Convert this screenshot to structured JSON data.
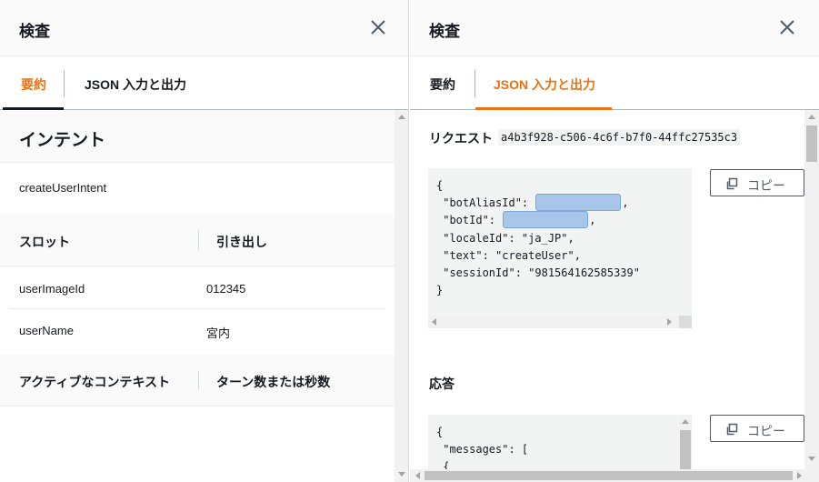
{
  "left_panel": {
    "title": "検査",
    "tabs": [
      {
        "label": "要約",
        "active": true
      },
      {
        "label": "JSON 入力と出力",
        "active": false
      }
    ],
    "intent_heading": "インテント",
    "intent_value": "createUserIntent",
    "slots_header": {
      "col1": "スロット",
      "col2": "引き出し"
    },
    "slots": [
      {
        "name": "userImageId",
        "value": "012345"
      },
      {
        "name": "userName",
        "value": "宮内"
      }
    ],
    "context_header": {
      "col1": "アクティブなコンテキスト",
      "col2": "ターン数または秒数"
    }
  },
  "right_panel": {
    "title": "検査",
    "tabs": [
      {
        "label": "要約",
        "active": false
      },
      {
        "label": "JSON 入力と出力",
        "active": true
      }
    ],
    "request_label": "リクエスト",
    "request_id": "a4b3f928-c506-4c6f-b7f0-44ffc27535c3",
    "request_json": {
      "open": "{",
      "bot_alias_key": " \"botAliasId\": ",
      "bot_alias_tail": ",",
      "bot_id_key": " \"botId\": ",
      "bot_id_tail": ",",
      "locale_line": " \"localeId\": \"ja_JP\",",
      "text_line": " \"text\": \"createUser\",",
      "session_line": " \"sessionId\": \"981564162585339\"",
      "close": "}"
    },
    "response_label": "応答",
    "response_json": {
      "open": "{",
      "messages_line": " \"messages\": ["
    },
    "copy_label": "コピー"
  },
  "colors": {
    "accent": "#ec7211",
    "text": "#16191f",
    "redaction": "#a8c6ea"
  }
}
